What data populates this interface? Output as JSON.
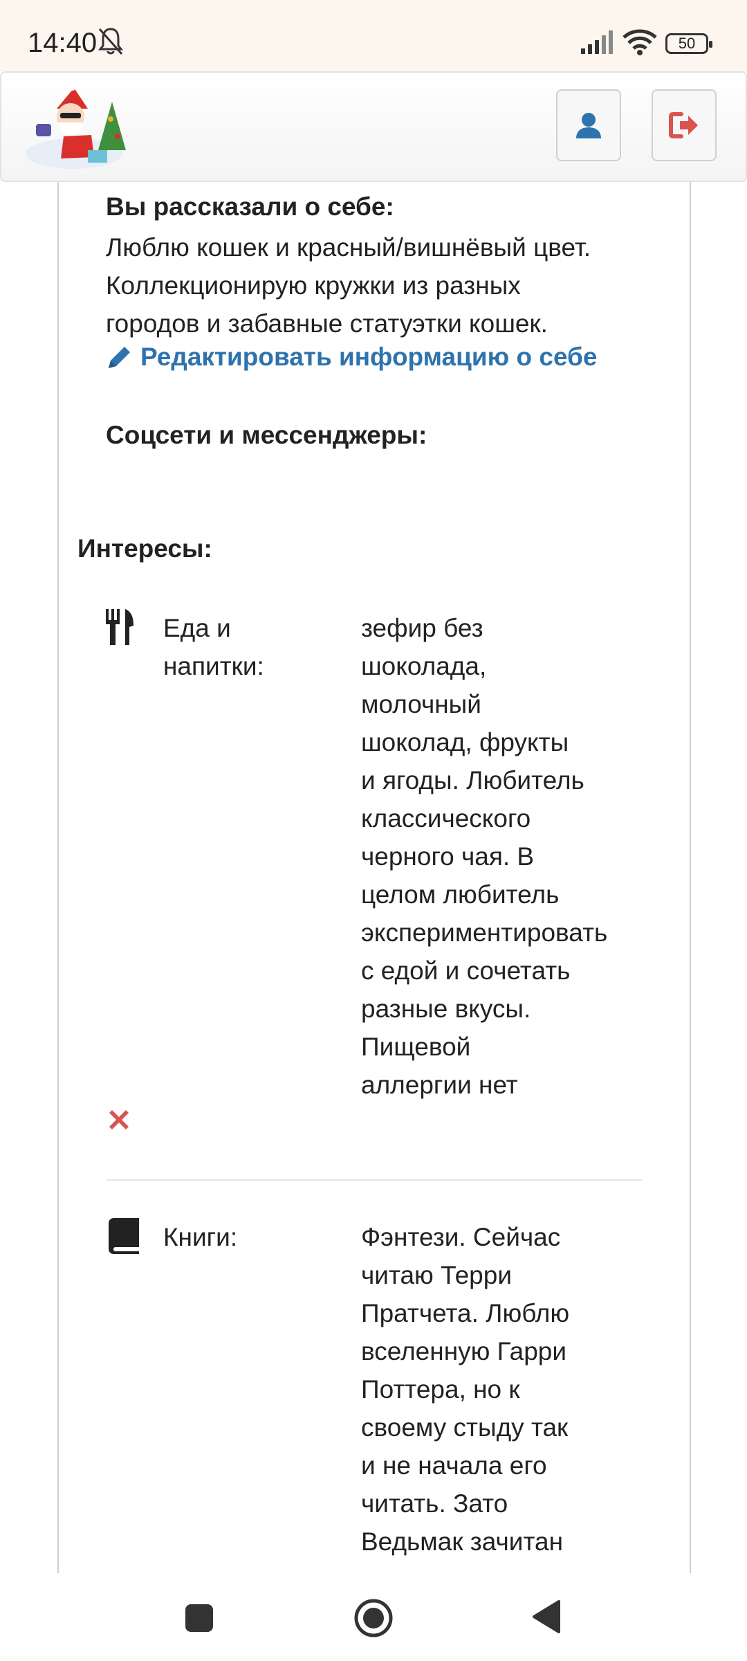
{
  "status_bar": {
    "time": "14:40",
    "battery": "50",
    "icons": [
      "bell-off-icon",
      "signal-icon",
      "wifi-icon",
      "battery-icon"
    ]
  },
  "header": {
    "logo": "santa-logo",
    "buttons": [
      {
        "name": "profile-button",
        "icon": "user-icon"
      },
      {
        "name": "logout-button",
        "icon": "sign-out-icon"
      }
    ]
  },
  "about": {
    "title": "Вы рассказали о себе:",
    "lines": [
      "Люблю кошек и красный/вишнёвый цвет.",
      "Коллекционирую кружки из разных",
      "городов и забавные статуэтки кошек."
    ],
    "edit_link": "Редактировать информацию о себе"
  },
  "social": {
    "title": "Соцсети и мессенджеры:"
  },
  "interests": {
    "title": "Интересы:",
    "items": [
      {
        "icon": "cutlery-icon",
        "label_lines": [
          "Еда и",
          "напитки:"
        ],
        "value_lines": [
          "зефир без",
          "шоколада,",
          "молочный",
          "шоколад, фрукты",
          "и ягоды. Любитель",
          "классического",
          "черного чая. В",
          "целом любитель",
          "экспериментировать",
          "с едой и сочетать",
          "разные вкусы.",
          "Пищевой",
          "аллергии нет"
        ]
      },
      {
        "icon": "book-icon",
        "label_lines": [
          "Книги:"
        ],
        "value_lines": [
          "Фэнтези. Сейчас",
          "читаю Терри",
          "Пратчета. Люблю",
          "вселенную Гарри",
          "Поттера, но к",
          "своему стыду так",
          "и не начала его",
          "читать. Зато",
          "Ведьмак зачитан"
        ]
      }
    ]
  },
  "colors": {
    "link": "#2e73ad",
    "remove": "#d9534f",
    "statusbar_bg": "#fcf6ef",
    "logout": "#d9534f",
    "profile": "#2e73ad"
  }
}
